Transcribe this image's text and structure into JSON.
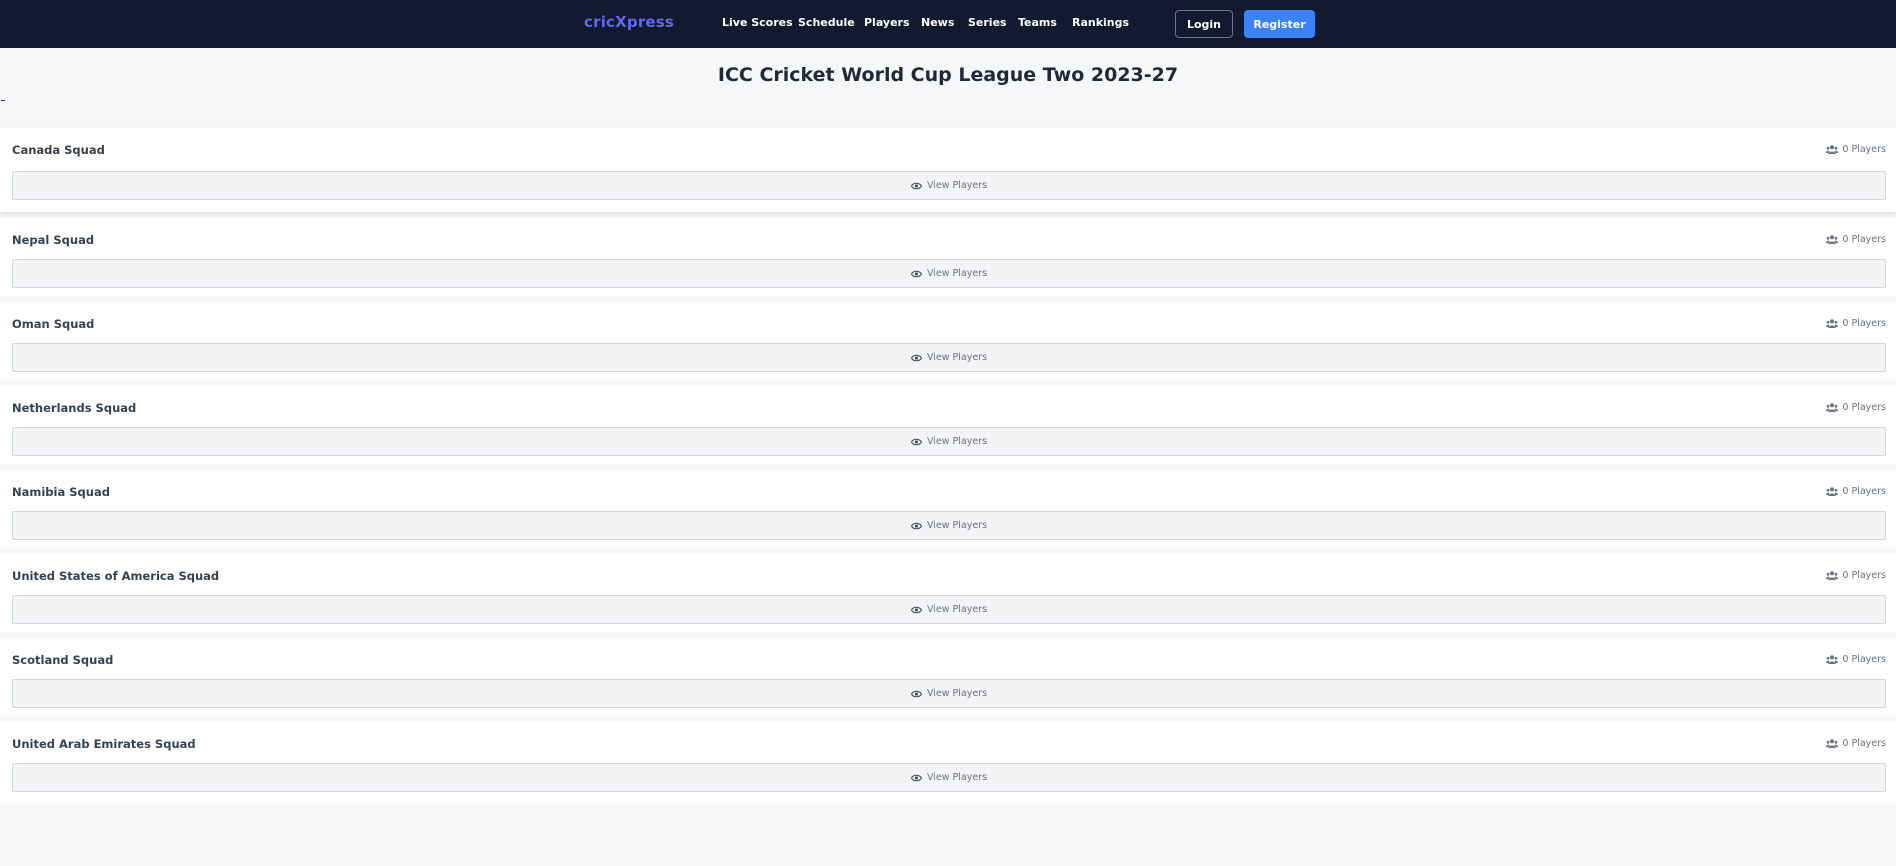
{
  "nav": {
    "logo": "cricXpress",
    "links": [
      "Live Scores",
      "Schedule",
      "Players",
      "News",
      "Series",
      "Teams",
      "Rankings"
    ],
    "login_label": "Login",
    "register_label": "Register",
    "bg_color": "#111a2e",
    "logo_color": "#6366f1",
    "register_color": "#3b82f6"
  },
  "page": {
    "title": "ICC Cricket World Cup League Two 2023-27"
  },
  "squads": [
    {
      "name": "Canada Squad",
      "count": "0 Players",
      "button": "View Players"
    },
    {
      "name": "Nepal Squad",
      "count": "0 Players",
      "button": "View Players"
    },
    {
      "name": "Oman Squad",
      "count": "0 Players",
      "button": "View Players"
    },
    {
      "name": "Netherlands Squad",
      "count": "0 Players",
      "button": "View Players"
    },
    {
      "name": "Namibia Squad",
      "count": "0 Players",
      "button": "View Players"
    },
    {
      "name": "United States of America Squad",
      "count": "0 Players",
      "button": "View Players"
    },
    {
      "name": "Scotland Squad",
      "count": "0 Players",
      "button": "View Players"
    },
    {
      "name": "United Arab Emirates Squad",
      "count": "0 Players",
      "button": "View Players"
    }
  ],
  "icons": {
    "count_icon": "users-icon",
    "button_icon": "eye-icon"
  }
}
